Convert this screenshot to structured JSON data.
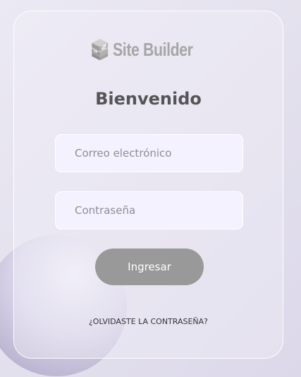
{
  "logo": {
    "text": "Site Builder",
    "icon": "stacked-cube-logo-icon"
  },
  "login": {
    "title": "Bienvenido",
    "email_placeholder": "Correo electrónico",
    "password_placeholder": "Contraseña",
    "submit_label": "Ingresar",
    "forgot_link": "¿OLVIDASTE LA CONTRASEÑA?"
  },
  "colors": {
    "button": "#999999",
    "field_background": "#f4f2fe",
    "title": "#555555",
    "logo": "#a6a6a6"
  }
}
